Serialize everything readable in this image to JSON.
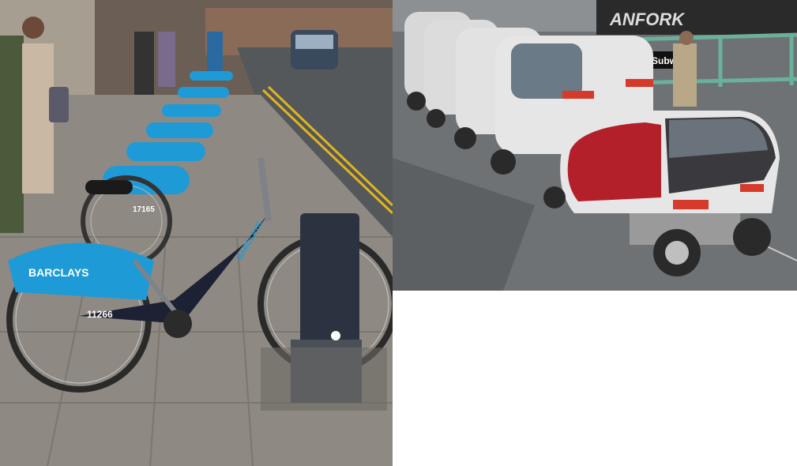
{
  "left_photo": {
    "brand_text": "BARCLAYS",
    "bike_number_front": "11266",
    "bike_number_second": "17165"
  },
  "right_photo": {
    "sign_text": "Subw",
    "graffiti_text": "ANFORK"
  },
  "colors": {
    "barclays_blue": "#1e9ad6",
    "bike_frame": "#1c2233",
    "dock_gray": "#2c3340",
    "pod_white": "#e6e6e6",
    "pod_red": "#b3202a",
    "road_yellow": "#e0b520"
  }
}
